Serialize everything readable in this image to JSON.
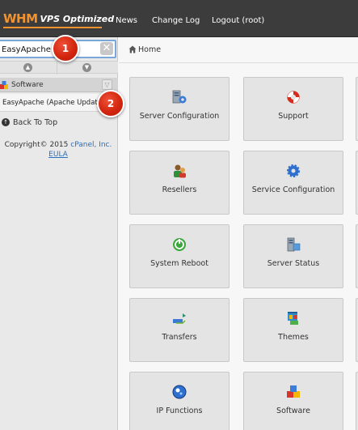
{
  "header": {
    "logo_main": "WHM",
    "logo_sub": "VPS Optimized",
    "nav": [
      {
        "label": "News"
      },
      {
        "label": "Change Log"
      },
      {
        "label": "Logout (root)"
      }
    ]
  },
  "sidebar": {
    "search_value": "EasyApache",
    "clear_glyph": "✕",
    "collapse_up_glyph": "▲",
    "collapse_down_glyph": "▼",
    "category": {
      "label": "Software",
      "chevron": "▽"
    },
    "result_item": {
      "label": "EasyApache (Apache Update)"
    },
    "back_to_top": {
      "glyph": "↑",
      "label": "Back To Top"
    },
    "copyright_text": "Copyright© 2015",
    "copyright_link": "cPanel, Inc.",
    "eula": "EULA"
  },
  "markers": [
    {
      "label": "1"
    },
    {
      "label": "2"
    }
  ],
  "breadcrumb": {
    "label": "Home"
  },
  "tiles": [
    {
      "label": "Server Configuration",
      "icon": "server-configuration-icon"
    },
    {
      "label": "Support",
      "icon": "support-lifebuoy-icon"
    },
    {
      "label": "Resellers",
      "icon": "resellers-users-icon"
    },
    {
      "label": "Service Configuration",
      "icon": "gear-icon"
    },
    {
      "label": "System Reboot",
      "icon": "power-icon"
    },
    {
      "label": "Server Status",
      "icon": "server-status-icon"
    },
    {
      "label": "Transfers",
      "icon": "transfers-icon"
    },
    {
      "label": "Themes",
      "icon": "themes-icon"
    },
    {
      "label": "IP Functions",
      "icon": "ip-network-icon"
    },
    {
      "label": "Software",
      "icon": "software-boxes-icon"
    }
  ],
  "colors": {
    "topbar": "#3c3c3c",
    "brand_orange": "#f3932f",
    "link_blue": "#2a6ebb",
    "marker_red": "#d3260f",
    "tile_bg": "#e4e4e4"
  }
}
